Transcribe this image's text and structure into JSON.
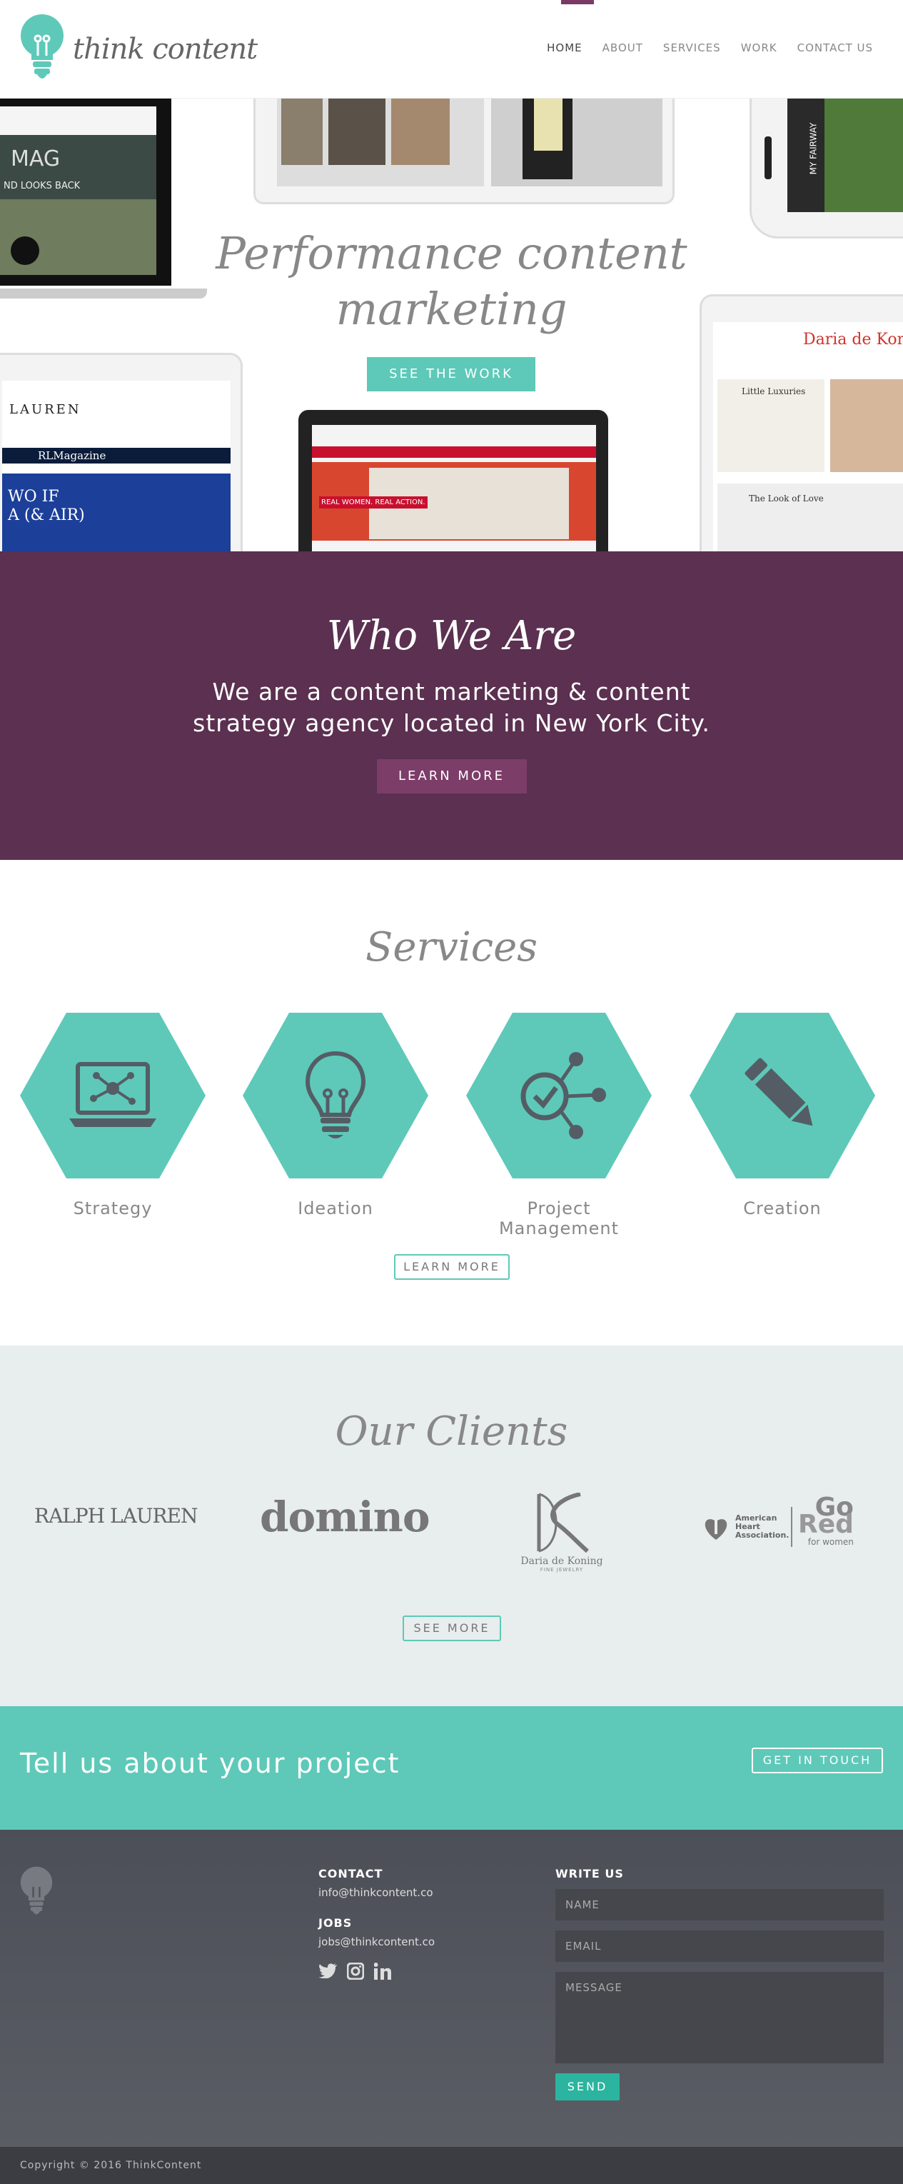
{
  "brand": {
    "name": "think content",
    "accent": "#5ec9b8",
    "plum": "#5b3050"
  },
  "nav": {
    "items": [
      "HOME",
      "ABOUT",
      "SERVICES",
      "WORK",
      "CONTACT US"
    ],
    "active": "HOME"
  },
  "hero": {
    "title_line1": "Performance content",
    "title_line2": "marketing",
    "button": "SEE THE WORK"
  },
  "who": {
    "title": "Who We Are",
    "line1": "We are a content marketing & content",
    "line2": "strategy agency located in New York City.",
    "button": "LEARN MORE"
  },
  "services": {
    "title": "Services",
    "items": [
      {
        "label": "Strategy",
        "icon": "laptop-network-icon"
      },
      {
        "label": "Ideation",
        "icon": "lightbulb-icon"
      },
      {
        "label": "Project Management",
        "icon": "network-target-icon"
      },
      {
        "label": "Creation",
        "icon": "pencil-icon"
      }
    ],
    "button": "LEARN MORE"
  },
  "clients": {
    "title": "Our Clients",
    "logos": [
      "RALPH LAUREN",
      "domino",
      "Daria de Koning",
      "American Heart Association / Go Red for women"
    ],
    "daria_sub": "FINE JEWELRY",
    "aha_text": "American Heart Association.",
    "gored_go": "Go",
    "gored_red": "Red",
    "gored_sub": "for women",
    "button": "SEE MORE"
  },
  "cta": {
    "text": "Tell us about your project",
    "button": "GET IN TOUCH"
  },
  "footer": {
    "contact_head": "CONTACT",
    "contact_email": "info@thinkcontent.co",
    "jobs_head": "JOBS",
    "jobs_email": "jobs@thinkcontent.co",
    "social": [
      "twitter-icon",
      "instagram-icon",
      "linkedin-icon"
    ],
    "write_head": "WRITE US",
    "name_placeholder": "NAME",
    "email_placeholder": "EMAIL",
    "message_placeholder": "MESSAGE",
    "send": "SEND"
  },
  "copyright": "Copyright © 2016 ThinkContent",
  "mockup_text": {
    "mag": "MAG",
    "mag_sub": "ND LOOKS BACK",
    "lauren": "LAUREN",
    "rl_magazine": "RLMagazine",
    "rl_story": "WO IF",
    "rl_story2": "A (& AIR)",
    "aha_banner": "REAL WOMEN. REAL ACTION.",
    "daria_title": "Daria de Kon",
    "little_luxuries": "Little Luxuries",
    "look_of_love": "The Look of Love",
    "my_fairway": "MY FAIRWAY"
  }
}
